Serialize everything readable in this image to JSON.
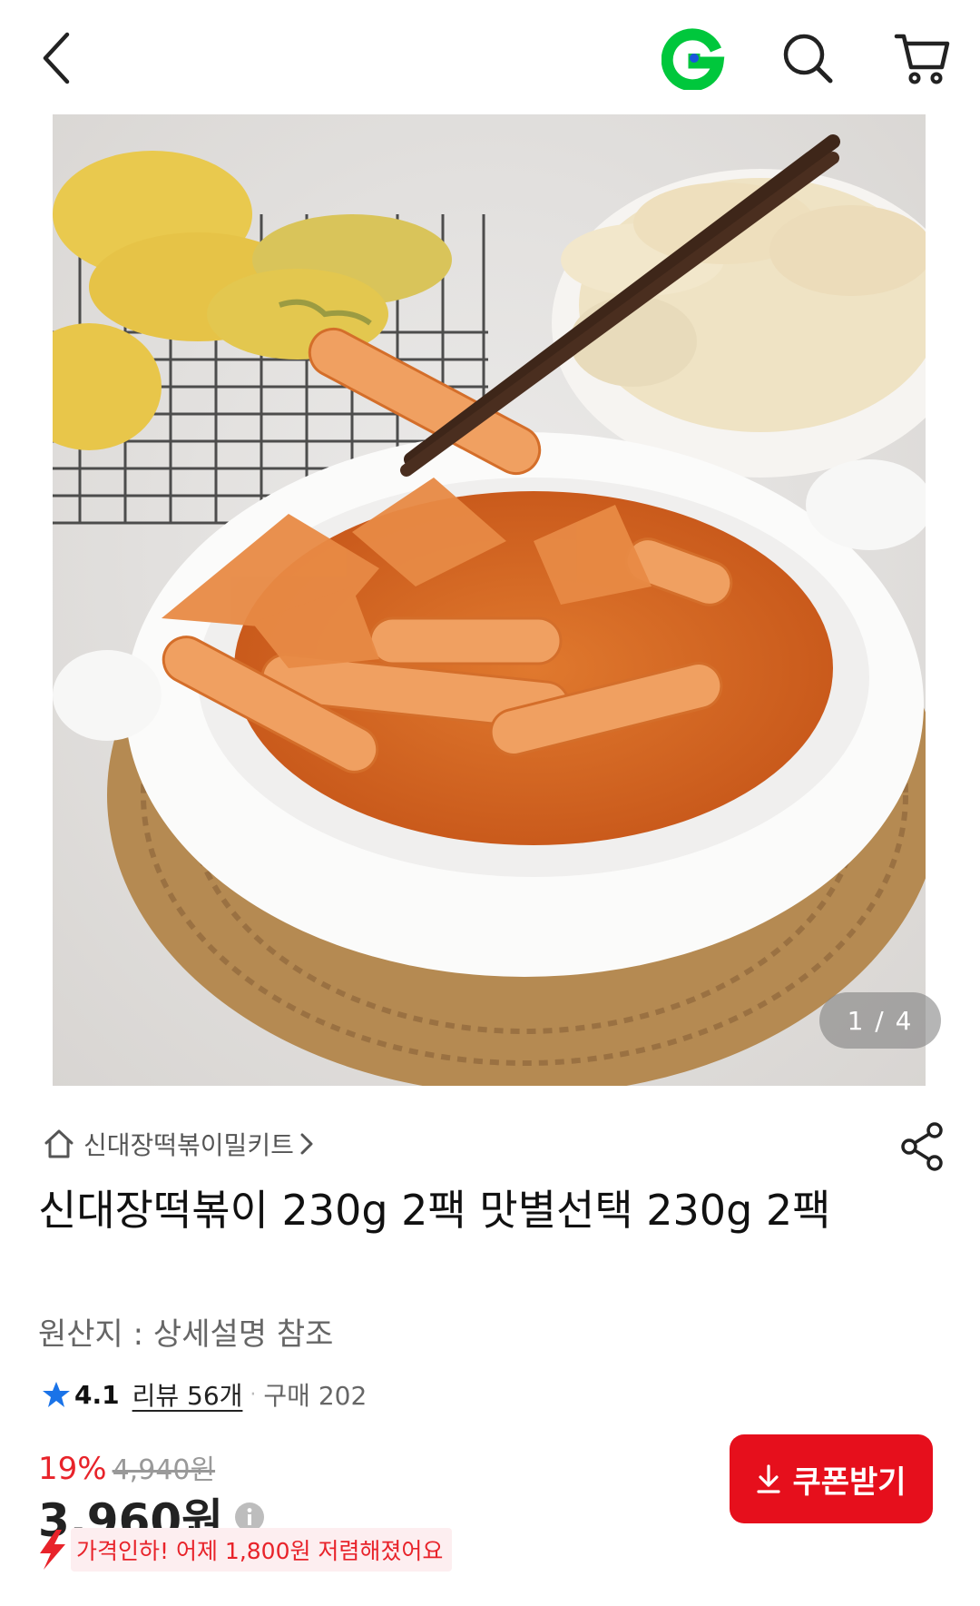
{
  "header": {
    "back_icon": "chevron-left-icon",
    "brand_icon": "g-logo-icon",
    "search_icon": "search-icon",
    "cart_icon": "cart-icon",
    "brand_color": "#00c73c"
  },
  "gallery": {
    "page_indicator": "1 / 4",
    "current_page": 1,
    "total_pages": 4
  },
  "breadcrumb": {
    "icon": "home-icon",
    "label": "신대장떡볶이밀키트"
  },
  "share_icon": "share-icon",
  "product": {
    "title": "신대장떡볶이 230g 2팩 맛별선택 230g 2팩",
    "origin": "원산지 : 상세설명 참조"
  },
  "rating": {
    "score": "4.1",
    "review_label": "리뷰 56개",
    "dot": "·",
    "purchase_label": "구매 202",
    "star_color": "#1a73e8"
  },
  "price": {
    "discount_rate": "19%",
    "original_price": "4,940원",
    "current_price": "3,960원",
    "accent_color": "#e8232a"
  },
  "coupon": {
    "label": "쿠폰받기",
    "button_color": "#e60f1c"
  },
  "price_drop": {
    "text": "가격인하! 어제 1,800원 저렴해졌어요"
  }
}
